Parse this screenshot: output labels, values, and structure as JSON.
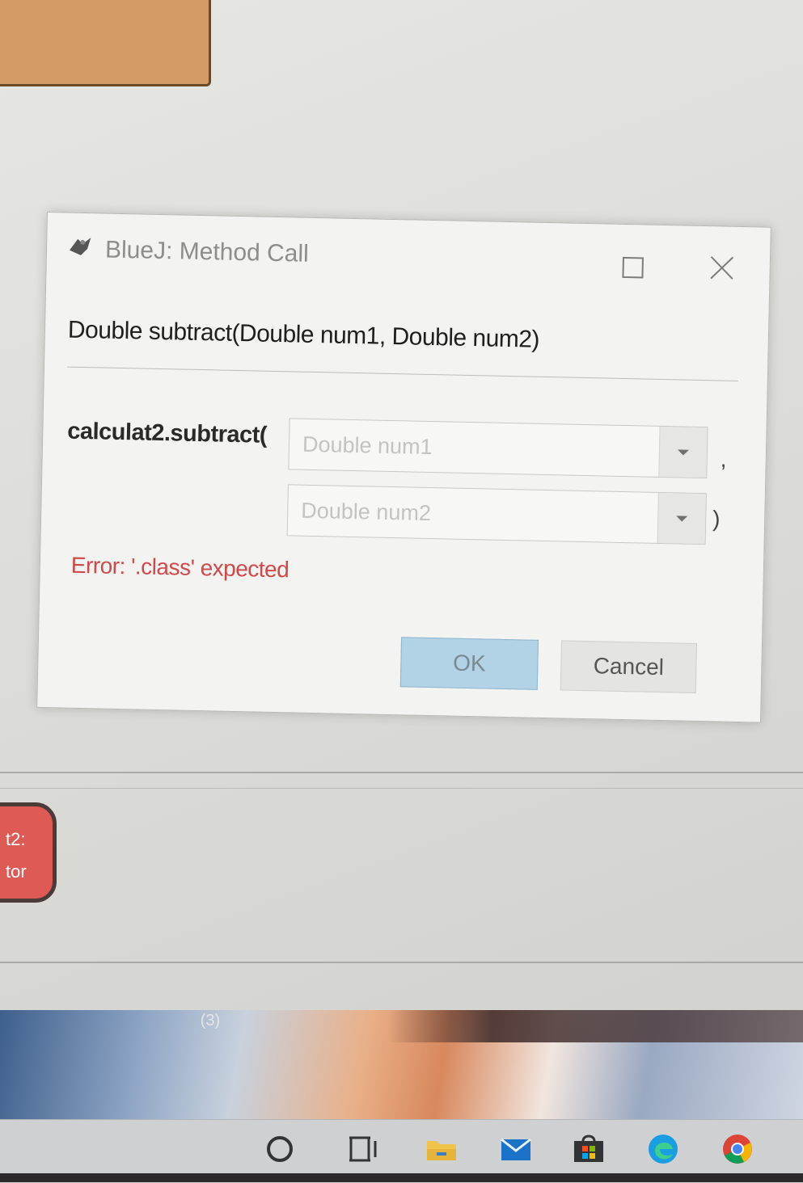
{
  "dialog": {
    "title": "BlueJ:  Method Call",
    "signature": "Double subtract(Double num1, Double num2)",
    "call_prefix": "calculat2.subtract(",
    "param1_placeholder": "Double num1",
    "param2_placeholder": "Double num2",
    "separator_comma": ",",
    "closing_paren": ")",
    "error": "Error: '.class' expected",
    "ok_label": "OK",
    "cancel_label": "Cancel"
  },
  "object_bench": {
    "line1": "t2:",
    "line2": "tor"
  },
  "desktop": {
    "notification_badge": "(3)"
  },
  "colors": {
    "ok_button": "#b2d2e6",
    "error_text": "#d04848",
    "object_item": "#de5b55"
  },
  "taskbar": {
    "icons": [
      "search-icon",
      "task-view-icon",
      "file-explorer-icon",
      "mail-icon",
      "store-icon",
      "edge-icon",
      "chrome-icon"
    ]
  }
}
